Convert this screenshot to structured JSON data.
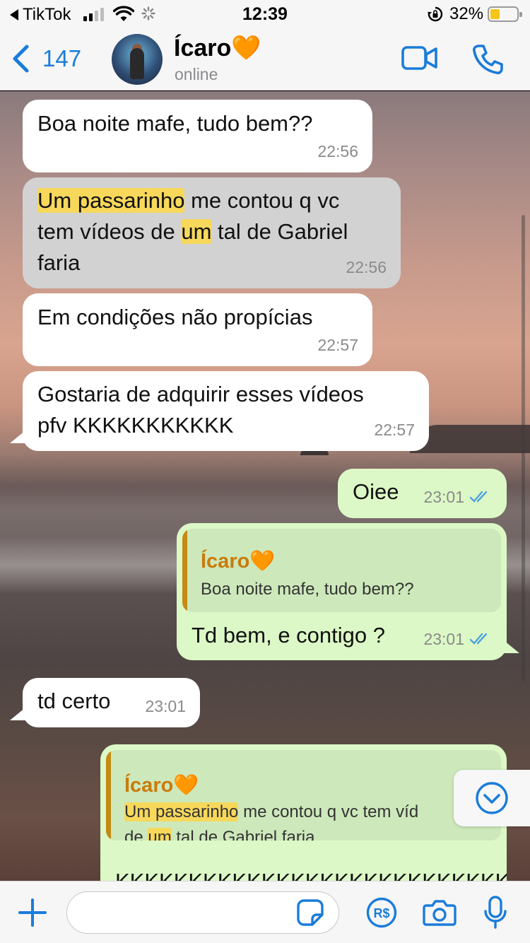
{
  "status_bar": {
    "back_app": "TikTok",
    "time": "12:39",
    "battery": "32%"
  },
  "header": {
    "back_count": "147",
    "name": "Ícaro🧡",
    "status": "online"
  },
  "messages": [
    {
      "dir": "in",
      "text": "Boa noite mafe, tudo bem??",
      "time": "22:56"
    },
    {
      "dir": "in",
      "selected": true,
      "hl1": "Um passarinho",
      "p1": " me contou q vc",
      "p2": "tem vídeos de ",
      "hl2": "um",
      "p3": " tal de Gabriel",
      "p4": "faria",
      "time": "22:56"
    },
    {
      "dir": "in",
      "text": "Em condições não propícias",
      "time": "22:57"
    },
    {
      "dir": "in",
      "line1": "Gostaria de adquirir esses vídeos",
      "line2": "pfv KKKKKKKKKKK",
      "time": "22:57"
    },
    {
      "dir": "out",
      "text": "Oiee",
      "time": "23:01"
    },
    {
      "dir": "out",
      "quote_name": "Ícaro🧡",
      "quote_text": "Boa noite mafe, tudo bem??",
      "text": "Td bem, e contigo ?",
      "time": "23:01"
    },
    {
      "dir": "in",
      "text": "td certo",
      "time": "23:01"
    },
    {
      "dir": "out",
      "quote_name": "Ícaro🧡",
      "q_hl1": "Um passarinho",
      "q_p1": " me contou q vc tem víd",
      "q_p2": "de ",
      "q_hl2": "um",
      "q_p3": " tal de Gabriel faria",
      "partial_text": "KKKKKKKKKKKKKKKKKKKKKKKKKKK"
    }
  ],
  "colors": {
    "accent": "#1a7cd9",
    "outgoing_bubble": "#dcf8c6",
    "incoming_bubble": "#ffffff",
    "highlight": "#f7d85b",
    "quote_name": "#c97b0b",
    "read_ticks": "#4fa3e0"
  },
  "icons": [
    "back-chevron-icon",
    "video-call-icon",
    "phone-icon",
    "chevron-down-icon",
    "plus-icon",
    "sticker-icon",
    "pix-payment-icon",
    "camera-icon",
    "microphone-icon",
    "read-receipt-icon"
  ]
}
